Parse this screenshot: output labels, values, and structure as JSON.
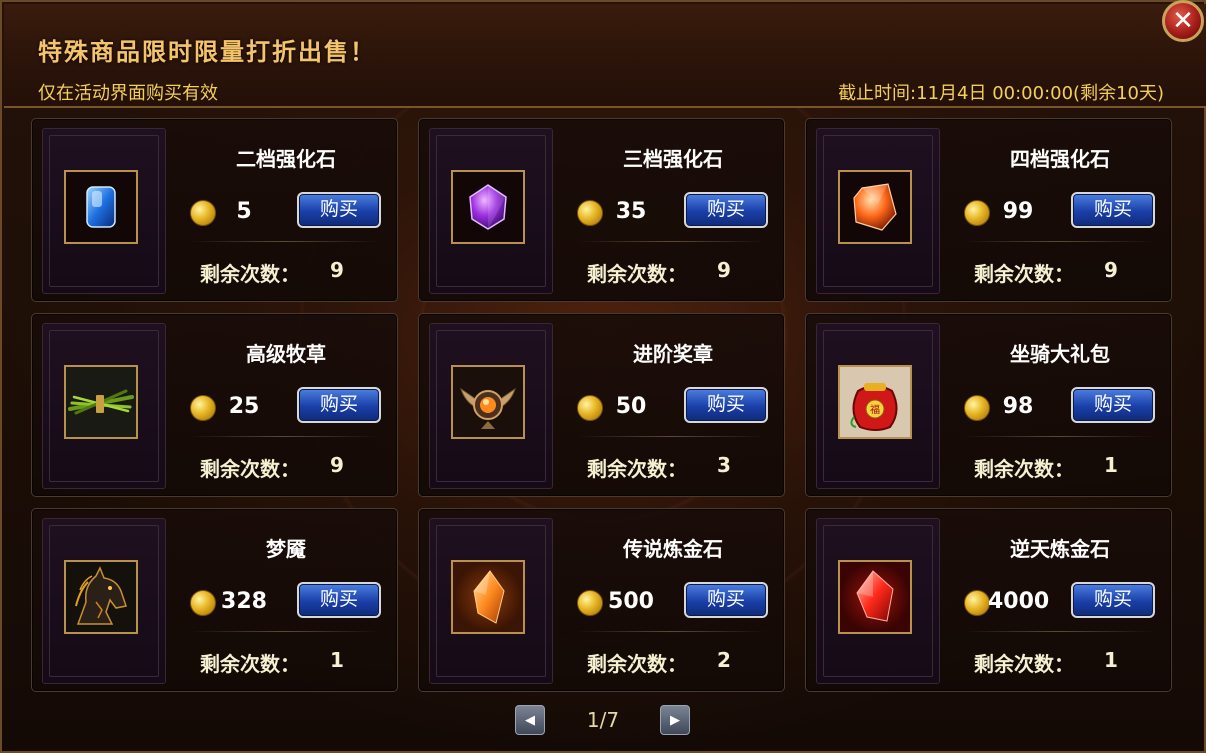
{
  "header": {
    "title": "特殊商品限时限量打折出售！",
    "subtitle": "仅在活动界面购买有效",
    "deadline": "截止时间:11月4日 00:00:00(剩余10天)"
  },
  "labels": {
    "buy": "购买",
    "remaining": "剩余次数："
  },
  "items": [
    {
      "name": "二档强化石",
      "price": "5",
      "remaining": "9",
      "icon": "blue-gem-icon"
    },
    {
      "name": "三档强化石",
      "price": "35",
      "remaining": "9",
      "icon": "purple-gem-icon"
    },
    {
      "name": "四档强化石",
      "price": "99",
      "remaining": "9",
      "icon": "orange-gem-icon"
    },
    {
      "name": "高级牧草",
      "price": "25",
      "remaining": "9",
      "icon": "grass-bundle-icon"
    },
    {
      "name": "进阶奖章",
      "price": "50",
      "remaining": "3",
      "icon": "winged-medal-icon"
    },
    {
      "name": "坐骑大礼包",
      "price": "98",
      "remaining": "1",
      "icon": "red-gift-bag-icon"
    },
    {
      "name": "梦魇",
      "price": "328",
      "remaining": "1",
      "icon": "nightmare-horse-icon"
    },
    {
      "name": "传说炼金石",
      "price": "500",
      "remaining": "2",
      "icon": "orange-crystal-icon"
    },
    {
      "name": "逆天炼金石",
      "price": "4000",
      "remaining": "1",
      "icon": "red-crystal-icon"
    }
  ],
  "pager": {
    "text": "1/7",
    "prev_glyph": "◀",
    "next_glyph": "▶"
  },
  "close_glyph": "✕",
  "colors": {
    "title": "#f5c46a",
    "subtitle": "#f2cf55",
    "buy_button": "#1a3fa8",
    "frame_gold": "#b8924c"
  }
}
